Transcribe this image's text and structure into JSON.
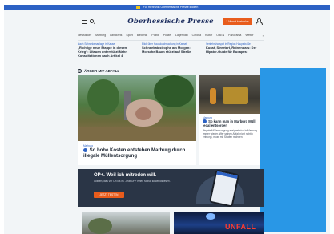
{
  "topbar": {
    "text": "Für mehr von Oberhessische Presse klicken"
  },
  "header": {
    "logo": "Oberhessische Presse",
    "cta_label": "1 Monat kostenlos"
  },
  "nav": {
    "items": [
      "Newsticker",
      "Marburg",
      "Landkreis",
      "Sport",
      "Biedenk.",
      "Politik",
      "Polizei",
      "Lagerblatt",
      "Corona",
      "Kultur",
      "OBEN",
      "Panorama",
      "Wetter"
    ]
  },
  "teasers": [
    {
      "kicker": "Nach Schrankenanlage in Kasse",
      "headline": "„Richtige neue Etappe in diesem Krieg“: Litauen unterstützt Nahr-Konsultationen nach Artikel 4"
    },
    {
      "kicker": "Blick über Hausdurchsuchung in Kassel",
      "headline": "Schneekatastrophe am Morgen: Morsche Baum stürzt auf Straße"
    },
    {
      "kicker": "Verkehrshotspot in Region Hauptstraße",
      "headline": "Kunst, Streetart, Ruinenbars: Der Hipster-Guide für Budapest"
    }
  ],
  "section": {
    "title": "ÄRGER MIT ABFALL"
  },
  "main_article": {
    "kicker": "Marburg",
    "headline": "So hohe Kosten entstehen Marburg durch illegale Müllentsorgung"
  },
  "side_article": {
    "kicker": "Marburg",
    "headline": "So kann man in Marburg Müll legal entsorgen",
    "body": "Illegale Müllentsorgung ereignet sich in Marburg immer wieder. Wer seinen Abfall nicht richtig entsorgt, muss mit Strafen rechnen."
  },
  "promo": {
    "title": "OP+. Weil ich mitreden will.",
    "text": "Wissen, was vor Ort los ist. Jetzt OP+ einen Monat kostenlos lesen.",
    "button_label": "JETZT TESTEN"
  },
  "bottom_right": {
    "sign_text": "UNFALL"
  },
  "colors": {
    "brand_blue": "#2d62c4",
    "cta_orange": "#e85c1c",
    "ad_blue": "#2997e6",
    "promo_bg": "#2a3546"
  }
}
